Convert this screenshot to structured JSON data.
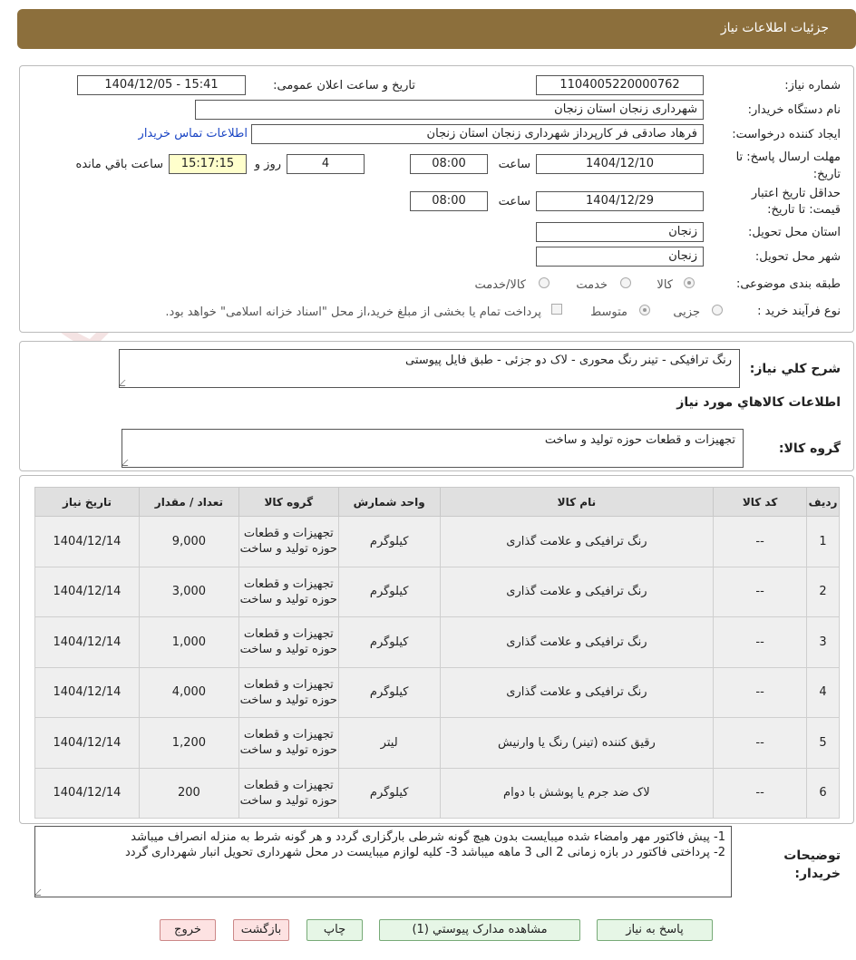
{
  "header": {
    "title": "جزئیات اطلاعات نیاز"
  },
  "form": {
    "need_number_label": "شماره نیاز:",
    "need_number": "1104005220000762",
    "announce_label": "تاریخ و ساعت اعلان عمومی:",
    "announce_value": "1404/12/05 - 15:41",
    "buyer_org_label": "نام دستگاه خریدار:",
    "buyer_org": "شهرداری زنجان استان زنجان",
    "requester_label": "ایجاد کننده درخواست:",
    "requester": "فرهاد صادقی فر کارپرداز شهرداری زنجان استان زنجان",
    "contact_link": "اطلاعات تماس خریدار",
    "deadline_label": "مهلت ارسال پاسخ: تا تاریخ:",
    "deadline_date": "1404/12/10",
    "time_label": "ساعت",
    "deadline_time": "08:00",
    "days_value": "4",
    "days_label": "روز و",
    "remaining_time": "15:17:15",
    "remaining_label": "ساعت باقي مانده",
    "validity_label": "حداقل تاریخ اعتبار قیمت: تا تاریخ:",
    "validity_date": "1404/12/29",
    "validity_time": "08:00",
    "province_label": "استان محل تحویل:",
    "province": "زنجان",
    "city_label": "شهر محل تحویل:",
    "city": "زنجان",
    "category_label": "طبقه بندی موضوعی:",
    "category_options": [
      "کالا",
      "خدمت",
      "کالا/خدمت"
    ],
    "process_label": "نوع فرآیند خرید :",
    "process_options": [
      "جزیی",
      "متوسط"
    ],
    "process_note": "پرداخت تمام یا بخشی از مبلغ خرید،از محل \"اسناد خزانه اسلامی\" خواهد بود."
  },
  "summary": {
    "desc_label": "شرح کلي نياز:",
    "desc_value": "رنگ ترافیکی - تینر رنگ محوری - لاک دو جزئی - طبق فایل پیوستی",
    "goods_info_title": "اطلاعات کالاهاي مورد نياز",
    "group_label": "گروه کالا:",
    "group_value": "تجهیزات و قطعات حوزه تولید و ساخت"
  },
  "table": {
    "headers": [
      "ردیف",
      "کد کالا",
      "نام کالا",
      "واحد شمارش",
      "گروه کالا",
      "تعداد / مقدار",
      "تاریخ نیاز"
    ],
    "rows": [
      {
        "idx": "1",
        "code": "--",
        "name": "رنگ ترافیکی و علامت گذاری",
        "unit": "کیلوگرم",
        "group": "تجهیزات و قطعات حوزه تولید و ساخت",
        "qty": "9,000",
        "date": "1404/12/14"
      },
      {
        "idx": "2",
        "code": "--",
        "name": "رنگ ترافیکی و علامت گذاری",
        "unit": "کیلوگرم",
        "group": "تجهیزات و قطعات حوزه تولید و ساخت",
        "qty": "3,000",
        "date": "1404/12/14"
      },
      {
        "idx": "3",
        "code": "--",
        "name": "رنگ ترافیکی و علامت گذاری",
        "unit": "کیلوگرم",
        "group": "تجهیزات و قطعات حوزه تولید و ساخت",
        "qty": "1,000",
        "date": "1404/12/14"
      },
      {
        "idx": "4",
        "code": "--",
        "name": "رنگ ترافیکی و علامت گذاری",
        "unit": "کیلوگرم",
        "group": "تجهیزات و قطعات حوزه تولید و ساخت",
        "qty": "4,000",
        "date": "1404/12/14"
      },
      {
        "idx": "5",
        "code": "--",
        "name": "رقیق کننده (تینر) رنگ یا وارنیش",
        "unit": "لیتر",
        "group": "تجهیزات و قطعات حوزه تولید و ساخت",
        "qty": "1,200",
        "date": "1404/12/14"
      },
      {
        "idx": "6",
        "code": "--",
        "name": "لاک ضد جرم یا پوشش با دوام",
        "unit": "کیلوگرم",
        "group": "تجهیزات و قطعات حوزه تولید و ساخت",
        "qty": "200",
        "date": "1404/12/14"
      }
    ]
  },
  "notes": {
    "label": "توضیحات خریدار:",
    "line1": "1- پیش فاکتور مهر وامضاء شده میبایست بدون هیچ گونه شرطی بارگزاری گردد و هر گونه شرط به منزله انصراف میباشد",
    "line2": "2- پرداختی فاکتور در بازه زمانی 2 الی 3 ماهه میباشد  3- کلیه لوازم میبایست در محل شهرداری تحویل انبار شهرداری گردد"
  },
  "buttons": {
    "reply": "پاسخ به نیاز",
    "attachments": "مشاهده مدارک پیوستي (1)",
    "print": "چاپ",
    "back": "بازگشت",
    "exit": "خروج"
  },
  "watermark": {
    "text": "AriaTender.net"
  },
  "colors": {
    "header_bg": "#8c6f3c",
    "link": "#1a45c4",
    "yellow_field": "#ffffcc",
    "green_button": "#e6f6e6",
    "pink_button": "#fde2e2"
  }
}
